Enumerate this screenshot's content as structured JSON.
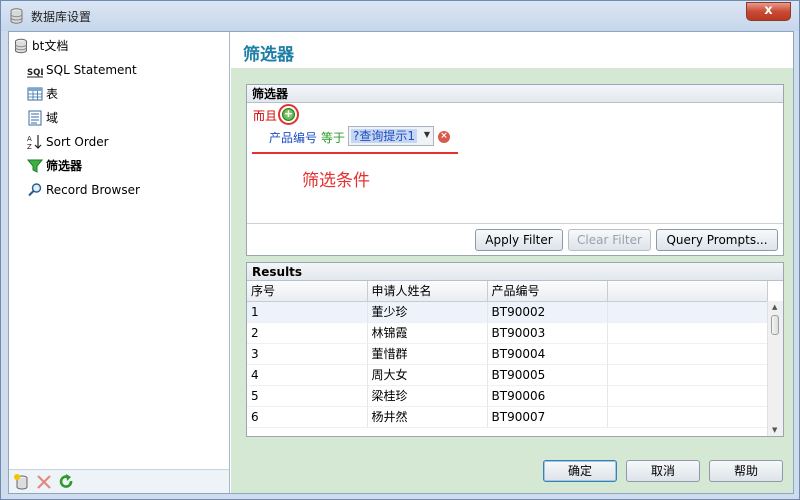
{
  "window": {
    "title": "数据库设置",
    "close_label": "x"
  },
  "nav": {
    "items": [
      {
        "label": "bt文档",
        "icon": "database-icon"
      },
      {
        "label": "SQL Statement",
        "icon": "sql-icon"
      },
      {
        "label": "表",
        "icon": "table-icon"
      },
      {
        "label": "域",
        "icon": "field-icon"
      },
      {
        "label": "Sort Order",
        "icon": "sort-icon"
      },
      {
        "label": "筛选器",
        "icon": "filter-icon",
        "active": true
      },
      {
        "label": "Record Browser",
        "icon": "magnifier-icon"
      }
    ]
  },
  "page": {
    "heading": "筛选器"
  },
  "filter_group": {
    "title": "筛选器",
    "and_label": "而且",
    "condition": {
      "field": "产品编号",
      "operator": "等于",
      "value": "?查询提示1"
    },
    "annotation": "筛选条件",
    "buttons": {
      "apply": "Apply Filter",
      "clear": "Clear Filter",
      "prompts": "Query Prompts..."
    }
  },
  "results": {
    "title": "Results",
    "columns": [
      "序号",
      "申请人姓名",
      "产品编号"
    ],
    "rows": [
      [
        "1",
        "董少珍",
        "BT90002"
      ],
      [
        "2",
        "林锦霞",
        "BT90003"
      ],
      [
        "3",
        "董惜群",
        "BT90004"
      ],
      [
        "4",
        "周大女",
        "BT90005"
      ],
      [
        "5",
        "梁桂珍",
        "BT90006"
      ],
      [
        "6",
        "杨井然",
        "BT90007"
      ]
    ]
  },
  "footer": {
    "ok": "确定",
    "cancel": "取消",
    "help": "帮助"
  },
  "colors": {
    "accent": "#1d7fa6",
    "content_bg": "#d5e8d4",
    "annotation": "#e53030",
    "condition_field": "#1d4ec0",
    "condition_operator": "#2a9a2a"
  }
}
